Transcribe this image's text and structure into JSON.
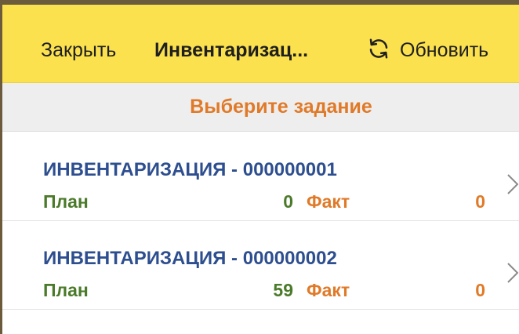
{
  "header": {
    "close_label": "Закрыть",
    "title": "Инвентаризац...",
    "refresh_label": "Обновить",
    "refresh_icon": "refresh-icon"
  },
  "subtitle": "Выберите задание",
  "tasks": [
    {
      "title": "ИНВЕНТАРИЗАЦИЯ - 000000001",
      "plan_label": "План",
      "plan_value": "0",
      "fact_label": "Факт",
      "fact_value": "0"
    },
    {
      "title": "ИНВЕНТАРИЗАЦИЯ - 000000002",
      "plan_label": "План",
      "plan_value": "59",
      "fact_label": "Факт",
      "fact_value": "0"
    }
  ],
  "colors": {
    "header_bg": "#fbe14e",
    "subtitle_bg": "#eeeeee",
    "accent_orange": "#e07a28",
    "title_blue": "#2d4e8f",
    "plan_green": "#4b7a2a"
  }
}
